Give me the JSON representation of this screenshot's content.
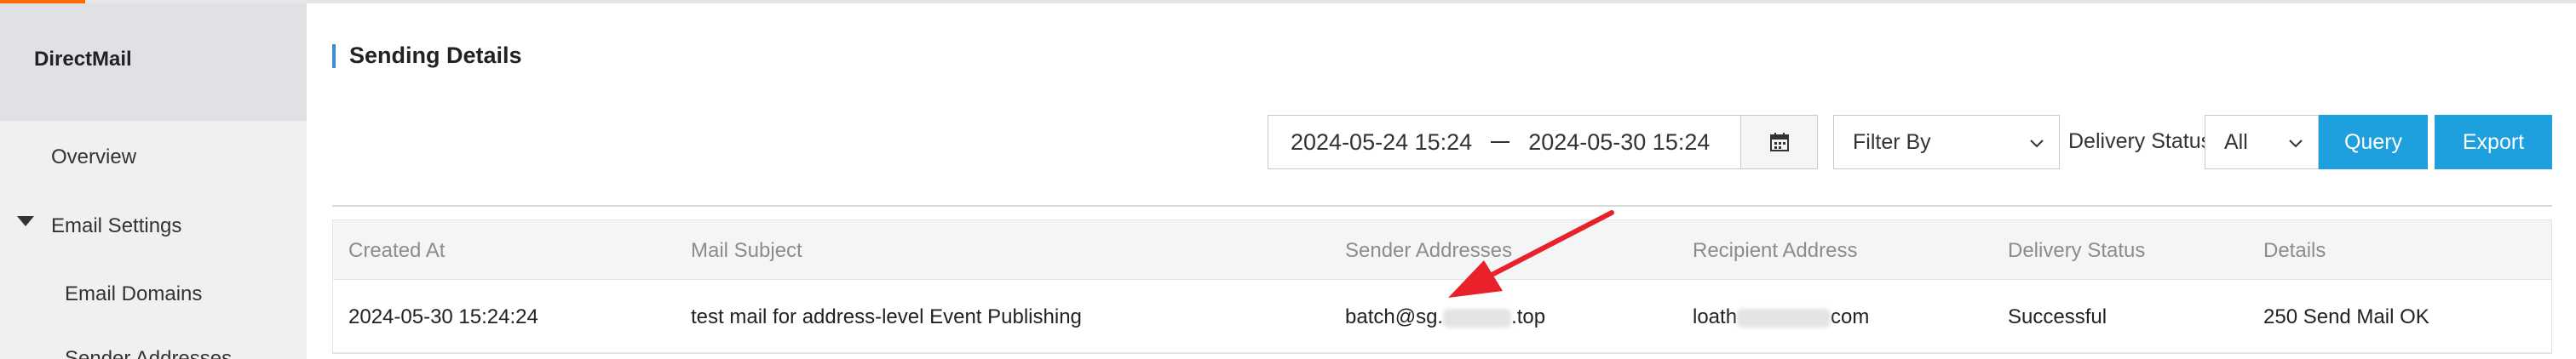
{
  "sidebar": {
    "brand": "DirectMail",
    "items": [
      {
        "label": "Overview"
      },
      {
        "label": "Email Settings"
      },
      {
        "label": "Email Domains"
      },
      {
        "label": "Sender Addresses"
      }
    ]
  },
  "page": {
    "title": "Sending Details"
  },
  "filters": {
    "date_from": "2024-05-24 15:24",
    "date_to": "2024-05-30 15:24",
    "filter_by": "Filter By",
    "status_label": "Delivery Status",
    "status_value": "All",
    "query_label": "Query",
    "export_label": "Export"
  },
  "table": {
    "columns": [
      "Created At",
      "Mail Subject",
      "Sender Addresses",
      "Recipient Address",
      "Delivery Status",
      "Details"
    ],
    "rows": [
      {
        "created_at": "2024-05-30 15:24:24",
        "subject": "test mail for address-level Event Publishing",
        "sender_prefix": "batch@sg.",
        "sender_suffix": ".top",
        "recipient_prefix": "loath",
        "recipient_suffix": "com",
        "status": "Successful",
        "details": "250 Send Mail OK"
      }
    ]
  },
  "colors": {
    "accent": "#1ea0de",
    "title_bar": "#3f8ccf",
    "annotation_arrow": "#e8212b"
  },
  "icons": [
    "calendar-icon",
    "chevron-down-icon",
    "caret-down-icon",
    "annotation-arrow"
  ]
}
